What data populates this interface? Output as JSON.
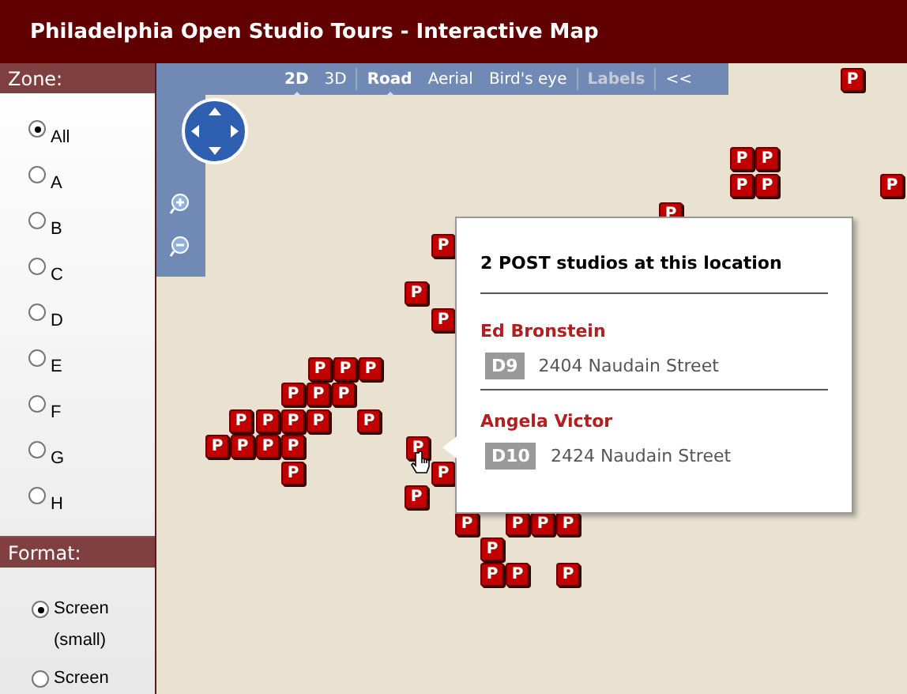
{
  "window": {
    "title": "Philadelphia Open Studio Tours - Interactive Map"
  },
  "sidebar": {
    "sections": [
      {
        "heading": "Zone:",
        "options": [
          {
            "label": "All",
            "selected": true
          },
          {
            "label": "A",
            "selected": false
          },
          {
            "label": "B",
            "selected": false
          },
          {
            "label": "C",
            "selected": false
          },
          {
            "label": "D",
            "selected": false
          },
          {
            "label": "E",
            "selected": false
          },
          {
            "label": "F",
            "selected": false
          },
          {
            "label": "G",
            "selected": false
          },
          {
            "label": "H",
            "selected": false
          }
        ]
      },
      {
        "heading": "Format:",
        "options": [
          {
            "label": "Screen (small)",
            "selected": true
          },
          {
            "label": "Screen",
            "selected": false
          }
        ]
      }
    ]
  },
  "map_toolbar": {
    "groups": [
      [
        {
          "label": "2D",
          "selected": true,
          "disabled": false
        },
        {
          "label": "3D",
          "selected": false,
          "disabled": false
        }
      ],
      [
        {
          "label": "Road",
          "selected": true,
          "disabled": false
        },
        {
          "label": "Aerial",
          "selected": false,
          "disabled": false
        },
        {
          "label": "Bird's eye",
          "selected": false,
          "disabled": false
        }
      ],
      [
        {
          "label": "Labels",
          "selected": false,
          "disabled": true
        }
      ]
    ],
    "collapse": "<<"
  },
  "markers": [
    {
      "label": "P"
    },
    {
      "label": "P"
    },
    {
      "label": "P"
    },
    {
      "label": "P"
    },
    {
      "label": "P"
    },
    {
      "label": "P"
    },
    {
      "label": "P"
    },
    {
      "label": "P"
    },
    {
      "label": "P"
    },
    {
      "label": "P"
    },
    {
      "label": "P"
    },
    {
      "label": "P"
    },
    {
      "label": "P"
    },
    {
      "label": "P"
    },
    {
      "label": "P"
    },
    {
      "label": "P"
    },
    {
      "label": "P"
    },
    {
      "label": "P"
    },
    {
      "label": "P"
    },
    {
      "label": "P"
    },
    {
      "label": "P"
    },
    {
      "label": "P"
    },
    {
      "label": "P"
    },
    {
      "label": "P"
    },
    {
      "label": "P"
    },
    {
      "label": "P"
    },
    {
      "label": "P"
    },
    {
      "label": "P"
    },
    {
      "label": "P"
    },
    {
      "label": "P"
    },
    {
      "label": "P"
    },
    {
      "label": "P"
    },
    {
      "label": "P"
    },
    {
      "label": "P"
    },
    {
      "label": "P"
    },
    {
      "label": "P"
    },
    {
      "label": "P"
    }
  ],
  "popup": {
    "title": "2 POST studios at this location",
    "studios": [
      {
        "name": "Ed Bronstein",
        "code": "D9",
        "address": "2404 Naudain Street"
      },
      {
        "name": "Angela Victor",
        "code": "D10",
        "address": "2424 Naudain Street"
      }
    ]
  }
}
